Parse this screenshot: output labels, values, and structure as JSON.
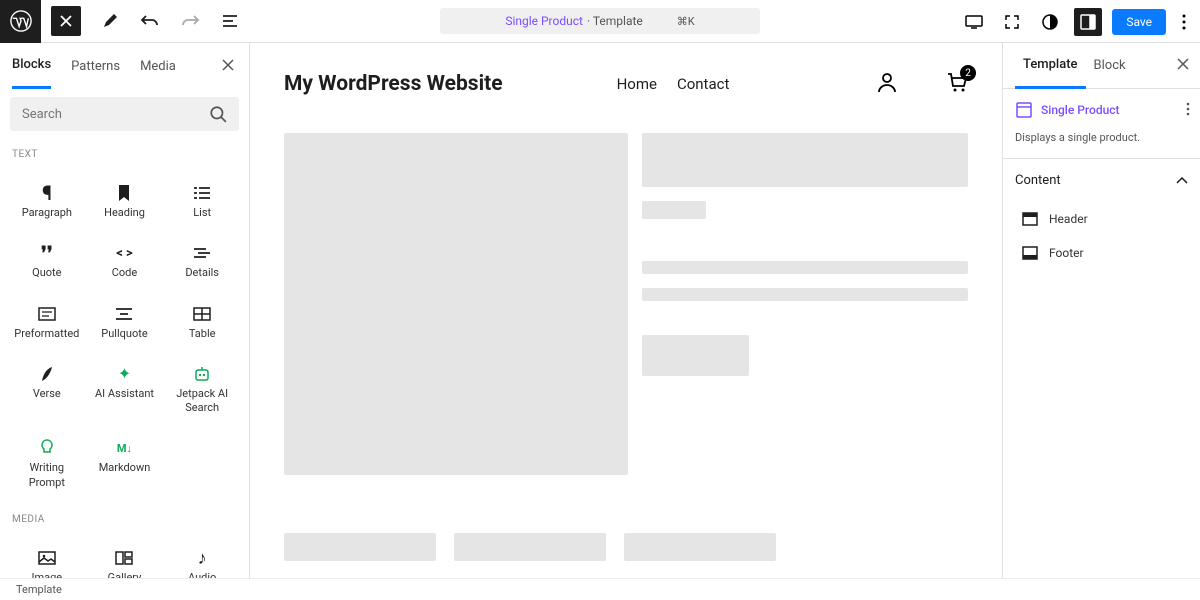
{
  "topbar": {
    "document_name": "Single Product",
    "document_type": "Template",
    "shortcut": "⌘K",
    "save_label": "Save"
  },
  "left_panel": {
    "tabs": [
      "Blocks",
      "Patterns",
      "Media"
    ],
    "active_tab": 0,
    "search_placeholder": "Search",
    "sections": [
      {
        "label": "TEXT",
        "items": [
          {
            "name": "paragraph",
            "label": "Paragraph",
            "glyph": "¶"
          },
          {
            "name": "heading",
            "label": "Heading",
            "glyph": "bookmark"
          },
          {
            "name": "list",
            "label": "List",
            "glyph": "list"
          },
          {
            "name": "quote",
            "label": "Quote",
            "glyph": "❞"
          },
          {
            "name": "code",
            "label": "Code",
            "glyph": "< >"
          },
          {
            "name": "details",
            "label": "Details",
            "glyph": "indent"
          },
          {
            "name": "preformatted",
            "label": "Preformatted",
            "glyph": "pre"
          },
          {
            "name": "pullquote",
            "label": "Pullquote",
            "glyph": "pull"
          },
          {
            "name": "table",
            "label": "Table",
            "glyph": "table"
          },
          {
            "name": "verse",
            "label": "Verse",
            "glyph": "feather"
          },
          {
            "name": "ai-assistant",
            "label": "AI Assistant",
            "glyph": "sparkle",
            "green": true
          },
          {
            "name": "jetpack-ai-search",
            "label": "Jetpack AI Search",
            "glyph": "robot",
            "green": true
          },
          {
            "name": "writing-prompt",
            "label": "Writing Prompt",
            "glyph": "bulb",
            "green": true
          },
          {
            "name": "markdown",
            "label": "Markdown",
            "glyph": "M↓",
            "green": true
          }
        ]
      },
      {
        "label": "MEDIA",
        "items": [
          {
            "name": "image",
            "label": "Image",
            "glyph": "image"
          },
          {
            "name": "gallery",
            "label": "Gallery",
            "glyph": "gallery"
          },
          {
            "name": "audio",
            "label": "Audio",
            "glyph": "♪"
          }
        ]
      }
    ]
  },
  "canvas": {
    "site_title": "My WordPress Website",
    "nav": [
      "Home",
      "Contact"
    ],
    "cart_count": "2"
  },
  "right_panel": {
    "tabs": [
      "Template",
      "Block"
    ],
    "active_tab": 0,
    "template_name": "Single Product",
    "template_desc": "Displays a single product.",
    "content_section_label": "Content",
    "content_items": [
      {
        "name": "header",
        "label": "Header",
        "icon": "header"
      },
      {
        "name": "footer",
        "label": "Footer",
        "icon": "footer"
      }
    ]
  },
  "footer_breadcrumb": "Template"
}
